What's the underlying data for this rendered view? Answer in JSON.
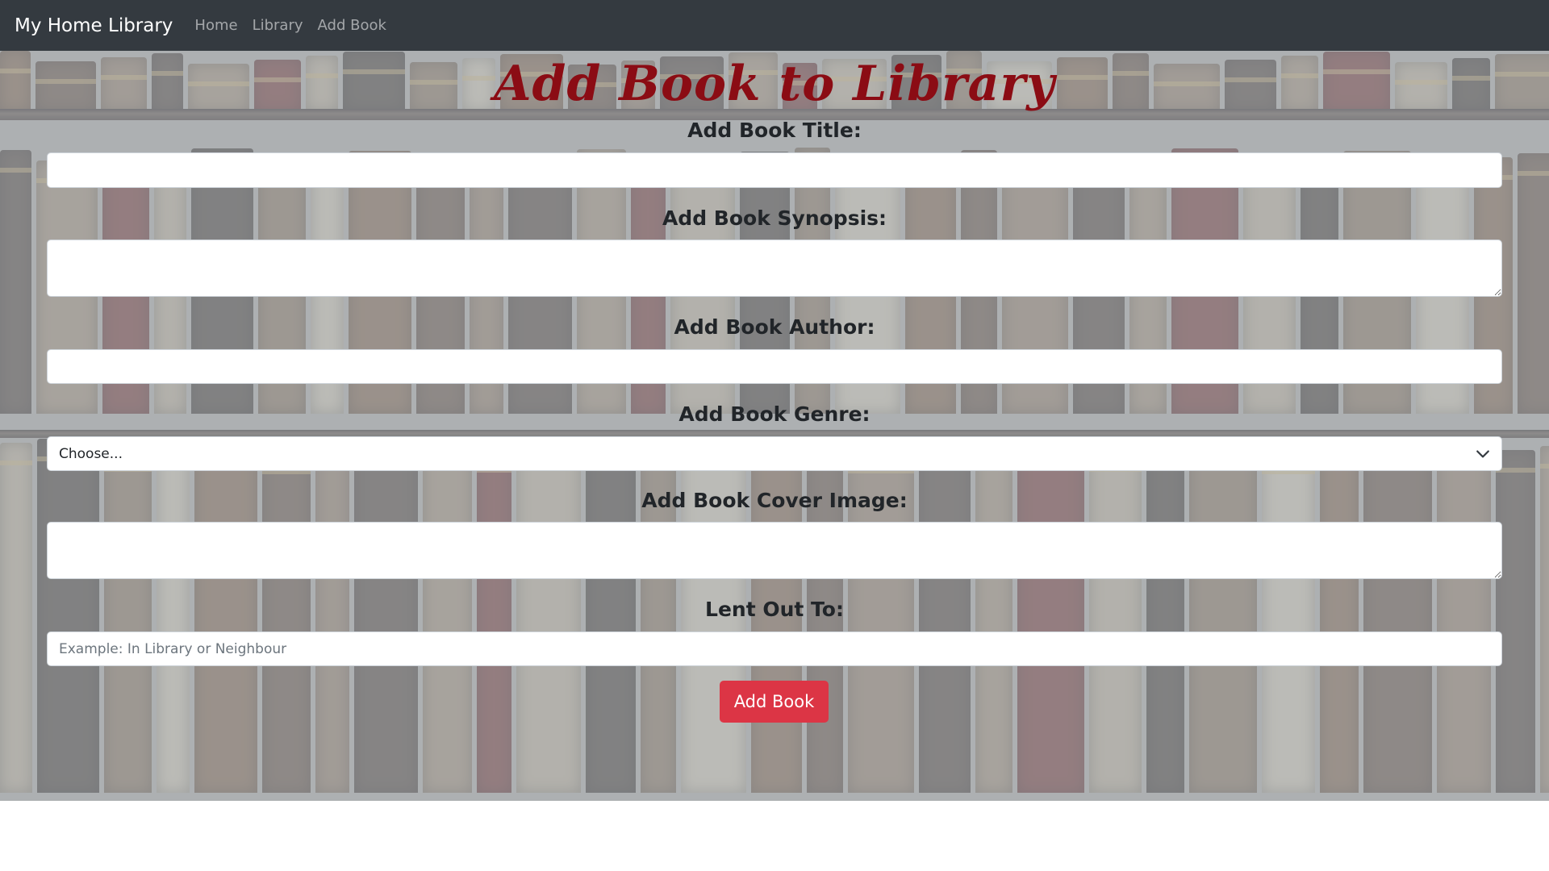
{
  "nav": {
    "brand": "My Home Library",
    "links": [
      "Home",
      "Library",
      "Add Book"
    ]
  },
  "page": {
    "title": "Add Book to Library"
  },
  "form": {
    "title_label": "Add Book Title:",
    "title_value": "",
    "synopsis_label": "Add Book Synopsis:",
    "synopsis_value": "",
    "author_label": "Add Book Author:",
    "author_value": "",
    "genre_label": "Add Book Genre:",
    "genre_selected": "Choose...",
    "cover_label": "Add Book Cover Image:",
    "cover_value": "",
    "lent_label": "Lent Out To:",
    "lent_placeholder": "Example: In Library or Neighbour",
    "submit_label": "Add Book"
  },
  "colors": {
    "navbar_bg": "#343a40",
    "title_color": "#8b0c14",
    "submit_bg": "#dc3545",
    "overlay": "#b2bac4"
  },
  "icons": {
    "select_chevron": "chevron-down-icon",
    "background": "bookshelf-background-image"
  }
}
